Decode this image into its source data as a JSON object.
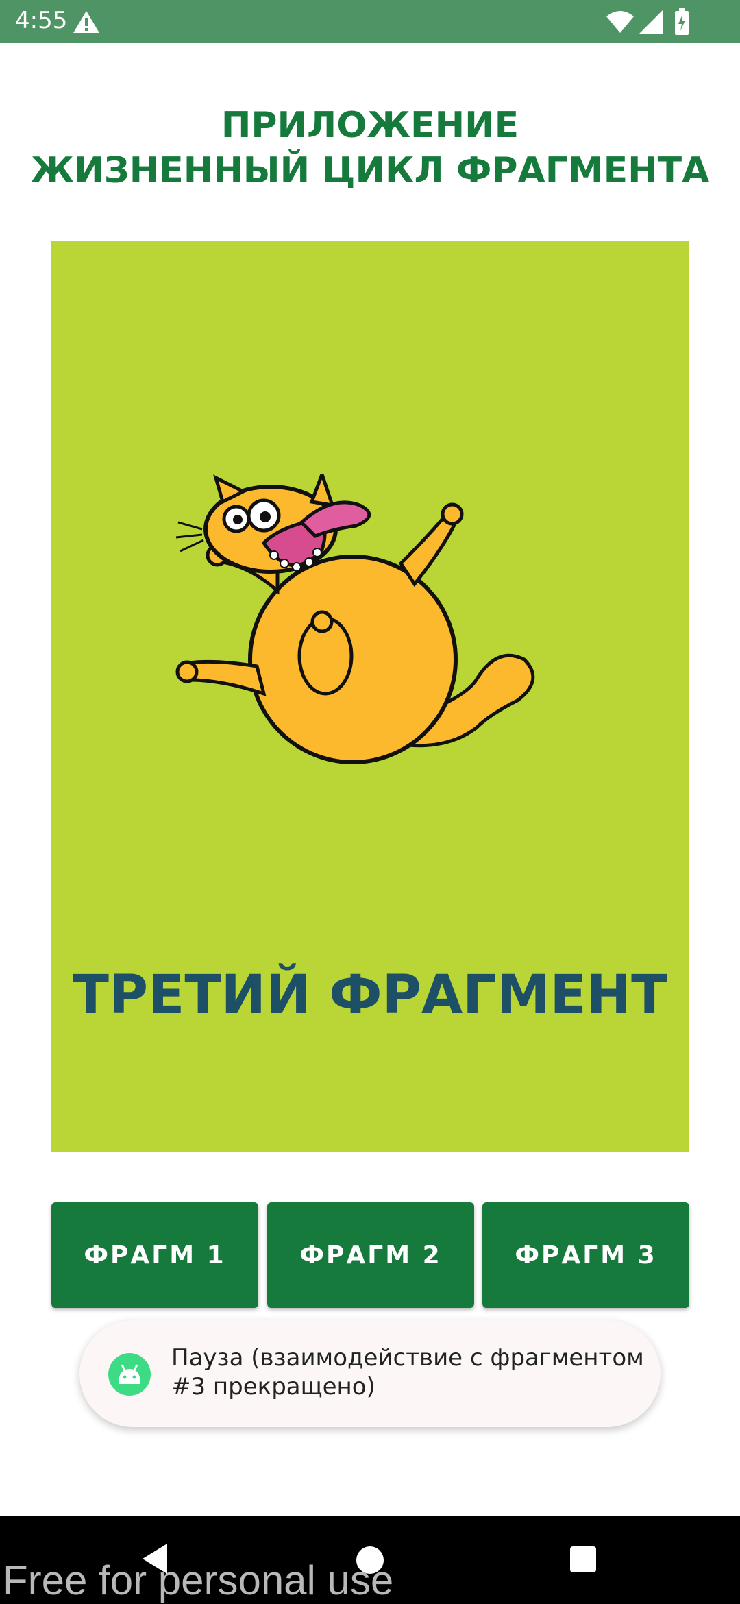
{
  "status_bar": {
    "time": "4:55",
    "icons": [
      "warning-icon",
      "wifi-icon",
      "signal-icon",
      "battery-icon"
    ],
    "background": "#4f9464"
  },
  "app": {
    "title_line1": "ПРИЛОЖЕНИЕ",
    "title_line2": "ЖИЗНЕННЫЙ ЦИКЛ ФРАГМЕНТА",
    "title_color": "#157a3c"
  },
  "fragment": {
    "label": "ТРЕТИЙ ФРАГМЕНТ",
    "background": "#bad636",
    "label_color": "#1d4f66"
  },
  "buttons": [
    {
      "label": "ФРАГМ 1"
    },
    {
      "label": "ФРАГМ 2"
    },
    {
      "label": "ФРАГМ 3"
    }
  ],
  "button_color": "#157a3c",
  "toast": {
    "icon": "android-icon",
    "line1": "Пауза (взаимодействие с фрагментом",
    "line2": "#3 прекращено)"
  },
  "nav_bar": {
    "buttons": [
      "back-icon",
      "home-icon",
      "recents-icon"
    ]
  },
  "watermark": "Free for personal use"
}
